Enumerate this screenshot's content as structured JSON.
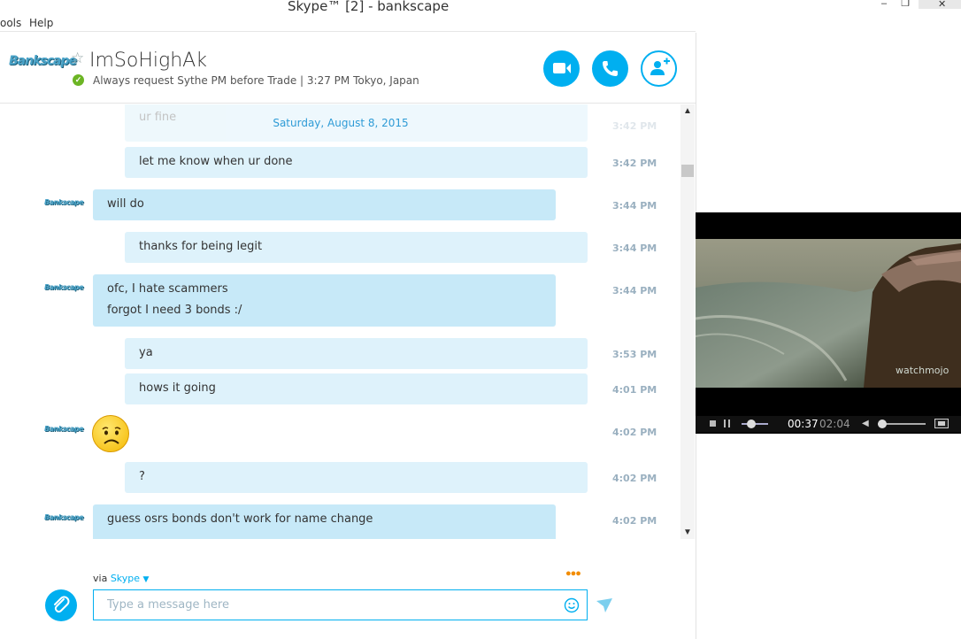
{
  "window": {
    "title": "Skype™ [2] - bankscape",
    "minimize": "–",
    "maximize": "❐",
    "close": "✕"
  },
  "menu": {
    "tools": "ools",
    "help": "Help"
  },
  "header": {
    "avatar_text": "Bankscape",
    "contact_name": "ImSoHighAk",
    "mood": "Always request Sythe PM before Trade  |  3:27 PM Tokyo, Japan"
  },
  "chat": {
    "date": "Saturday, August 8, 2015",
    "partial_top": "ur fine",
    "partial_top_time": "3:42 PM",
    "messages": [
      {
        "from": "me",
        "lines": [
          "let me know when ur done"
        ],
        "time": "3:42 PM"
      },
      {
        "from": "them",
        "lines": [
          "will do"
        ],
        "time": "3:44 PM"
      },
      {
        "from": "me",
        "lines": [
          "thanks for being legit"
        ],
        "time": "3:44 PM"
      },
      {
        "from": "them",
        "lines": [
          "ofc, I hate scammers",
          "forgot I need 3 bonds :/"
        ],
        "time": "3:44 PM"
      },
      {
        "from": "me",
        "lines": [
          "ya"
        ],
        "time": "3:53 PM"
      },
      {
        "from": "me",
        "lines": [
          "hows it going"
        ],
        "time": "4:01 PM"
      },
      {
        "from": "them",
        "lines": [
          ""
        ],
        "time": "4:02 PM",
        "emoji": "sad-face"
      },
      {
        "from": "me",
        "lines": [
          "?"
        ],
        "time": "4:02 PM"
      },
      {
        "from": "them",
        "lines": [
          "guess osrs bonds don't work for name change"
        ],
        "time": "4:02 PM"
      }
    ],
    "avatar_small": "Bankscape"
  },
  "compose": {
    "via": "via",
    "via_service": "Skype",
    "placeholder": "Type a message here"
  },
  "video": {
    "time_current": "00:37",
    "time_total": "02:04",
    "watermark": "watchmojo",
    "seek_progress": 0.3,
    "volume_level": 0.0
  },
  "colors": {
    "accent": "#00aff0",
    "bubble_out": "#def2fb",
    "bubble_in": "#c7e9f8",
    "online": "#6cb524",
    "date_text": "#2e9bd6"
  }
}
